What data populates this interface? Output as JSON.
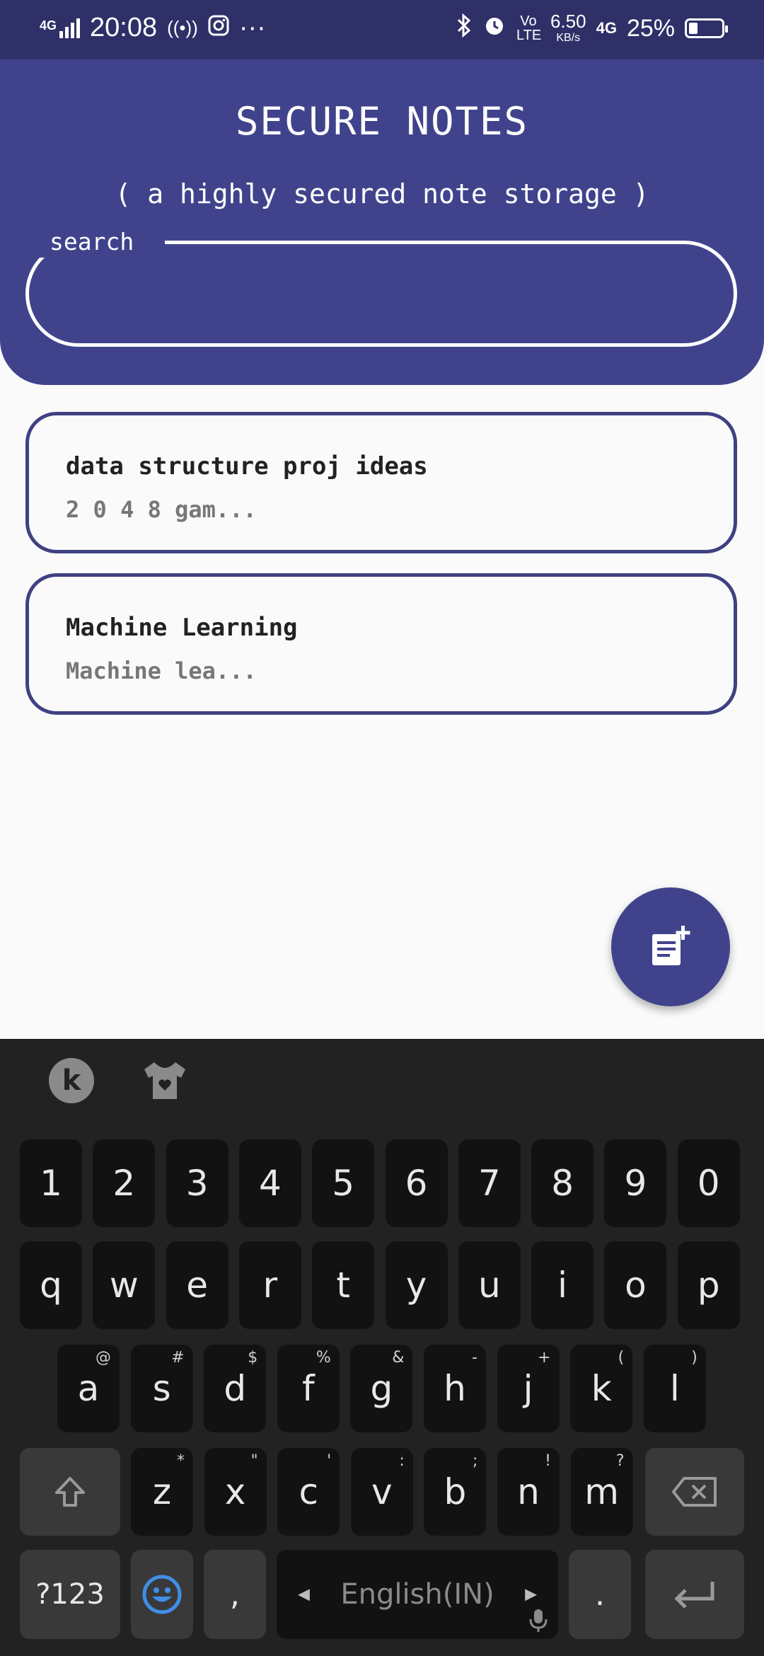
{
  "status_bar": {
    "network": "4G",
    "time": "20:08",
    "speed_value": "6.50",
    "speed_unit": "KB/s",
    "volte": "Vo LTE",
    "network_right": "4G",
    "battery": "25%",
    "icons": [
      "signal-icon",
      "hotspot-icon",
      "instagram-icon",
      "more-dots-icon",
      "bluetooth-icon",
      "alarm-icon",
      "battery-icon"
    ]
  },
  "header": {
    "title": "SECURE NOTES",
    "subtitle": "( a highly secured note storage )",
    "search_label": "search",
    "search_value": ""
  },
  "notes": [
    {
      "title": "data structure proj ideas",
      "preview": "2 0 4 8 gam..."
    },
    {
      "title": "Machine Learning",
      "preview": "Machine lea..."
    }
  ],
  "fab": {
    "icon": "add-note-icon"
  },
  "keyboard": {
    "tools": [
      "kika-icon",
      "theme-shirt-icon"
    ],
    "row_numbers": [
      "1",
      "2",
      "3",
      "4",
      "5",
      "6",
      "7",
      "8",
      "9",
      "0"
    ],
    "row_q": [
      "q",
      "w",
      "e",
      "r",
      "t",
      "y",
      "u",
      "i",
      "o",
      "p"
    ],
    "row_a": [
      "a",
      "s",
      "d",
      "f",
      "g",
      "h",
      "j",
      "k",
      "l"
    ],
    "row_a_hints": [
      "@",
      "#",
      "$",
      "%",
      "&",
      "-",
      "+",
      "(",
      ")"
    ],
    "row_z": [
      "z",
      "x",
      "c",
      "v",
      "b",
      "n",
      "m"
    ],
    "row_z_hints": [
      "*",
      "\"",
      "'",
      ":",
      ";",
      "!",
      "?"
    ],
    "symbols_label": "?123",
    "comma": ",",
    "space_label": "English(IN)",
    "period": "."
  },
  "colors": {
    "primary": "#40438c",
    "status_bar": "#2f3068",
    "background": "#fafafa",
    "keyboard_bg": "#222222",
    "key_bg": "#121212",
    "key_special_bg": "#393939"
  }
}
